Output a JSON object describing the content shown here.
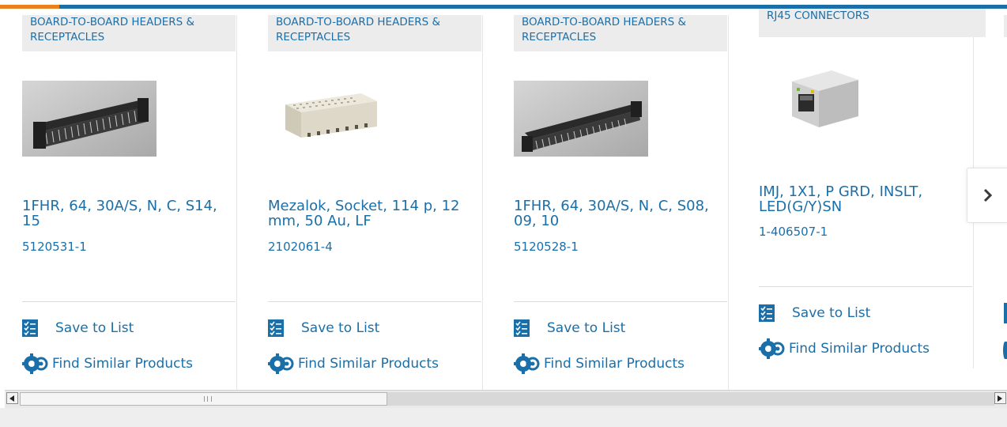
{
  "cards": [
    {
      "category": "BOARD-TO-BOARD HEADERS & RECEPTACLES",
      "title": "1FHR, 64, 30A/S, N, C, S14, 15",
      "part_number": "5120531-1",
      "image": "right-angle-header-image",
      "save_label": "Save to List",
      "find_label": "Find Similar Products"
    },
    {
      "category": "BOARD-TO-BOARD HEADERS & RECEPTACLES",
      "title": "Mezalok, Socket, 114 p, 12 mm, 50 Au, LF",
      "part_number": "2102061-4",
      "image": "mezzanine-socket-image",
      "save_label": "Save to List",
      "find_label": "Find Similar Products"
    },
    {
      "category": "BOARD-TO-BOARD HEADERS & RECEPTACLES",
      "title": "1FHR, 64, 30A/S, N, C, S08, 09, 10",
      "part_number": "5120528-1",
      "image": "right-angle-header-image",
      "save_label": "Save to List",
      "find_label": "Find Similar Products"
    },
    {
      "category": "RJ45 CONNECTORS",
      "title": "IMJ, 1X1, P GRD, INSLT, LED(G/Y)SN",
      "part_number": "1-406507-1",
      "image": "rj45-jack-image",
      "save_label": "Save to List",
      "find_label": "Find Similar Products"
    }
  ],
  "carousel": {
    "next_icon": "chevron-right-icon"
  },
  "scrollbar": {
    "left_icon": "arrow-left-icon",
    "right_icon": "arrow-right-icon",
    "position": 0.0
  },
  "colors": {
    "link_blue": "#1b6fa8",
    "accent_orange": "#e8821e",
    "category_bg": "#ececec"
  }
}
